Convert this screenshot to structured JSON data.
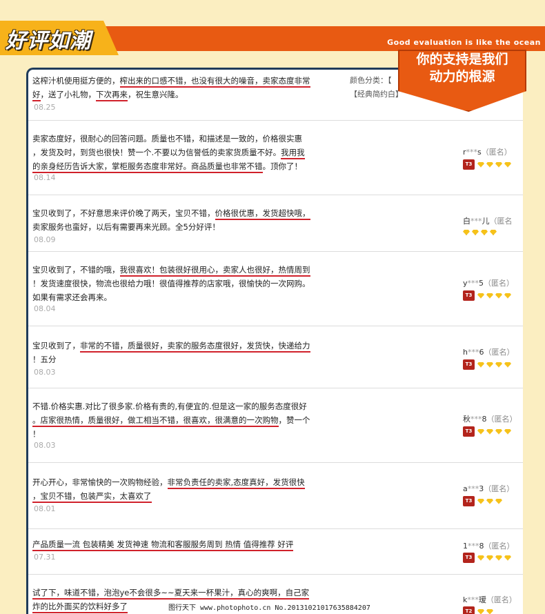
{
  "header": {
    "title": "好评如潮",
    "subtitle_en": "Good evaluation is like the ocean",
    "callout_line1": "你的支持是我们",
    "callout_line2": "动力的根源"
  },
  "meta": {
    "color_label": "颜色分类：【",
    "color_value": "【经典简约白】"
  },
  "reviews": [
    {
      "date": "08.25",
      "user": "",
      "user_mask": "",
      "user_tail": "",
      "anon": "",
      "gems": 0,
      "tmall": false
    },
    {
      "date": "08.14",
      "user": "r",
      "user_mask": "***",
      "user_tail": "s",
      "anon": "（匿名）",
      "gems": 4,
      "tmall": true
    },
    {
      "date": "08.09",
      "user": "白",
      "user_mask": "***",
      "user_tail": "儿",
      "anon": "（匿名",
      "gems": 4,
      "tmall": false
    },
    {
      "date": "08.04",
      "user": "y",
      "user_mask": "***",
      "user_tail": "5",
      "anon": "（匿名）",
      "gems": 4,
      "tmall": true
    },
    {
      "date": "08.03",
      "user": "h",
      "user_mask": "***",
      "user_tail": "6",
      "anon": "（匿名）",
      "gems": 4,
      "tmall": true
    },
    {
      "date": "08.03",
      "user": "秋",
      "user_mask": "***",
      "user_tail": "8",
      "anon": "（匿名）",
      "gems": 4,
      "tmall": true
    },
    {
      "date": "08.01",
      "user": "a",
      "user_mask": "***",
      "user_tail": "3",
      "anon": "（匿名）",
      "gems": 3,
      "tmall": true
    },
    {
      "date": "07.31",
      "user": "1",
      "user_mask": "***",
      "user_tail": "8",
      "anon": "（匿名）",
      "gems": 4,
      "tmall": true
    },
    {
      "date": "",
      "user": "k",
      "user_mask": "***",
      "user_tail": "瑷",
      "anon": "（匿名）",
      "gems": 2,
      "tmall": true
    }
  ],
  "text": {
    "r0a": "这榨汁机使用挺方便的，",
    "r0b": "榨出来的口感不错，也没有很大的噪音，卖家态度非常",
    "r0c": "好",
    "r0d": "，送了小礼物，",
    "r0e": "下次再来",
    "r0f": "，祝生意兴隆。",
    "r1a": "卖家态度好，很耐心的回答问题。质量也不错，和描述是一致的，价格很实惠",
    "r1b": "，发货及时，到货也很快！赞一个.不要以为信誉低的卖家货质量不好。",
    "r1c": "我用我",
    "r1d": "的亲身经历告诉大家，掌柜服务态度非常好。商品质量也非常不错",
    "r1e": "。顶你了！",
    "r2a": "宝贝收到了，不好意思来评价晚了两天，宝贝不错，",
    "r2b": "价格很优惠，发货超快哦，",
    "r2c": "卖家服务也蛮好，以后有需要再来光顾。全5分好评！",
    "r3a": "宝贝收到了，不错的哦，",
    "r3b": "我很喜欢！包装很好很用心，卖家人也很好，热情周到",
    "r3c": "！发货速度很快，物流也很给力哦！很值得推荐的店家哦，很愉快的一次网购。",
    "r3d": "如果有需求还会再来。",
    "r4a": "宝贝收到了，",
    "r4b": "非常的不错，质量很好，卖家的服务态度很好，发货快，快递给力",
    "r4c": "！五分",
    "r5a": "不错.价格实惠.对比了很多家.价格有贵的,有便宜的.但是这一家的服务态度很好",
    "r5b": "。店家很热情，质量很好，做工相当不错，很喜欢，很满意的一次购物",
    "r5c": "，赞一个",
    "r5d": "！",
    "r6a": "开心开心，非常愉快的一次购物经验，",
    "r6b": "非常负责任的卖家,态度真好，发货很快",
    "r6c": "，宝贝不错，",
    "r6d": "包装严实，太喜欢了",
    "r7a": "产品质量一流 包装精美 发货神速 物流和客服服务周到 热情 值得推荐 好评",
    "r8a": "试了下，味道不错，泡泡ye不会很多~~夏天来一杯果汁，真心的爽啊，自己家",
    "r8b": "炸的比外面买的饮料好多了"
  },
  "watermark": "图行天下 www.photophoto.cn  No.20131021017635884207"
}
